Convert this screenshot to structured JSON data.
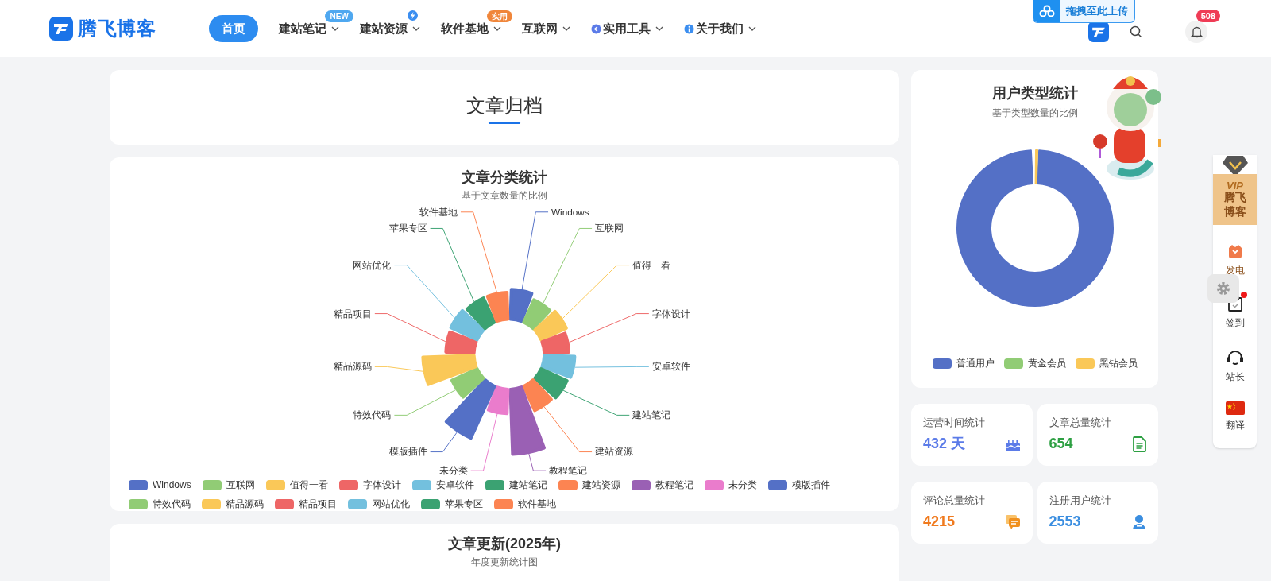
{
  "header": {
    "logo_text": "腾飞博客",
    "nav": [
      {
        "label": "首页",
        "selected": true,
        "dropdown": false,
        "kind": "plain"
      },
      {
        "label": "建站笔记",
        "selected": false,
        "dropdown": true,
        "kind": "plain",
        "badge": {
          "kind": "text",
          "text": "NEW",
          "color": "#4fa8f0"
        }
      },
      {
        "label": "建站资源",
        "selected": false,
        "dropdown": true,
        "kind": "plain",
        "badge": {
          "kind": "bolt",
          "color": "#3b8ef0"
        }
      },
      {
        "label": "软件基地",
        "selected": false,
        "dropdown": true,
        "kind": "plain",
        "badge": {
          "kind": "text",
          "text": "实用",
          "color": "#f0863a"
        }
      },
      {
        "label": "互联网",
        "selected": false,
        "dropdown": true,
        "kind": "plain"
      },
      {
        "label": "实用工具",
        "selected": false,
        "dropdown": true,
        "kind": "tool"
      },
      {
        "label": "关于我们",
        "selected": false,
        "dropdown": true,
        "kind": "info"
      }
    ],
    "upload": {
      "label": "拖拽至此上传"
    },
    "notifications": {
      "count": "508"
    }
  },
  "archive": {
    "title": "文章归档"
  },
  "category_chart": {
    "title": "文章分类统计",
    "subtitle": "基于文章数量的比例",
    "labels": [
      {
        "text": "软件基地"
      },
      {
        "text": "Windows"
      },
      {
        "text": "苹果专区"
      },
      {
        "text": "互联网"
      },
      {
        "text": "网站优化"
      },
      {
        "text": "值得一看"
      },
      {
        "text": "精品项目"
      },
      {
        "text": "字体设计"
      },
      {
        "text": "精品源码"
      },
      {
        "text": "安卓软件"
      },
      {
        "text": "特效代码"
      },
      {
        "text": "建站笔记"
      },
      {
        "text": "模版插件"
      },
      {
        "text": "建站资源"
      },
      {
        "text": "未分类"
      },
      {
        "text": "教程笔记"
      }
    ],
    "legend": [
      {
        "name": "Windows",
        "color": "#5470c6"
      },
      {
        "name": "互联网",
        "color": "#91cc75"
      },
      {
        "name": "值得一看",
        "color": "#fac858"
      },
      {
        "name": "字体设计",
        "color": "#ee6666"
      },
      {
        "name": "安卓软件",
        "color": "#73c0de"
      },
      {
        "name": "建站笔记",
        "color": "#3ba272"
      },
      {
        "name": "建站资源",
        "color": "#fc8452"
      },
      {
        "name": "教程笔记",
        "color": "#9a60b4"
      },
      {
        "name": "未分类",
        "color": "#ea7ccc"
      },
      {
        "name": "模版插件",
        "color": "#5470c6"
      },
      {
        "name": "特效代码",
        "color": "#91cc75"
      },
      {
        "name": "精品源码",
        "color": "#fac858"
      },
      {
        "name": "精品项目",
        "color": "#ee6666"
      },
      {
        "name": "网站优化",
        "color": "#73c0de"
      },
      {
        "name": "苹果专区",
        "color": "#3ba272"
      },
      {
        "name": "软件基地",
        "color": "#fc8452"
      }
    ]
  },
  "update_chart": {
    "title": "文章更新(2025年)",
    "subtitle": "年度更新统计图"
  },
  "user_chart": {
    "title": "用户类型统计",
    "subtitle": "基于类型数量的比例",
    "types": [
      {
        "name": "普通用户",
        "color": "#5470c6"
      },
      {
        "name": "黄金会员",
        "color": "#91cc75"
      },
      {
        "name": "黑钻会员",
        "color": "#fac858"
      }
    ]
  },
  "stats": [
    {
      "label": "运营时间统计",
      "value": "432 天",
      "kind": "days",
      "color": "#5b7be8"
    },
    {
      "label": "文章总量统计",
      "value": "654",
      "kind": "articles",
      "color": "#2ea043"
    },
    {
      "label": "评论总量统计",
      "value": "4215",
      "kind": "comments",
      "color": "#f07a1e"
    },
    {
      "label": "注册用户统计",
      "value": "2553",
      "kind": "users",
      "color": "#3b8ee0"
    }
  ],
  "side_bar": {
    "vip": {
      "badge": "VIP",
      "name_top": "腾飞",
      "name_bottom": "博客"
    },
    "items": [
      {
        "label": "发电",
        "kind": "gift",
        "notification": false
      },
      {
        "label": "签到",
        "kind": "checkin",
        "notification": true
      },
      {
        "label": "站长",
        "kind": "support",
        "notification": false
      },
      {
        "label": "翻译",
        "kind": "flag",
        "notification": false
      }
    ]
  }
}
